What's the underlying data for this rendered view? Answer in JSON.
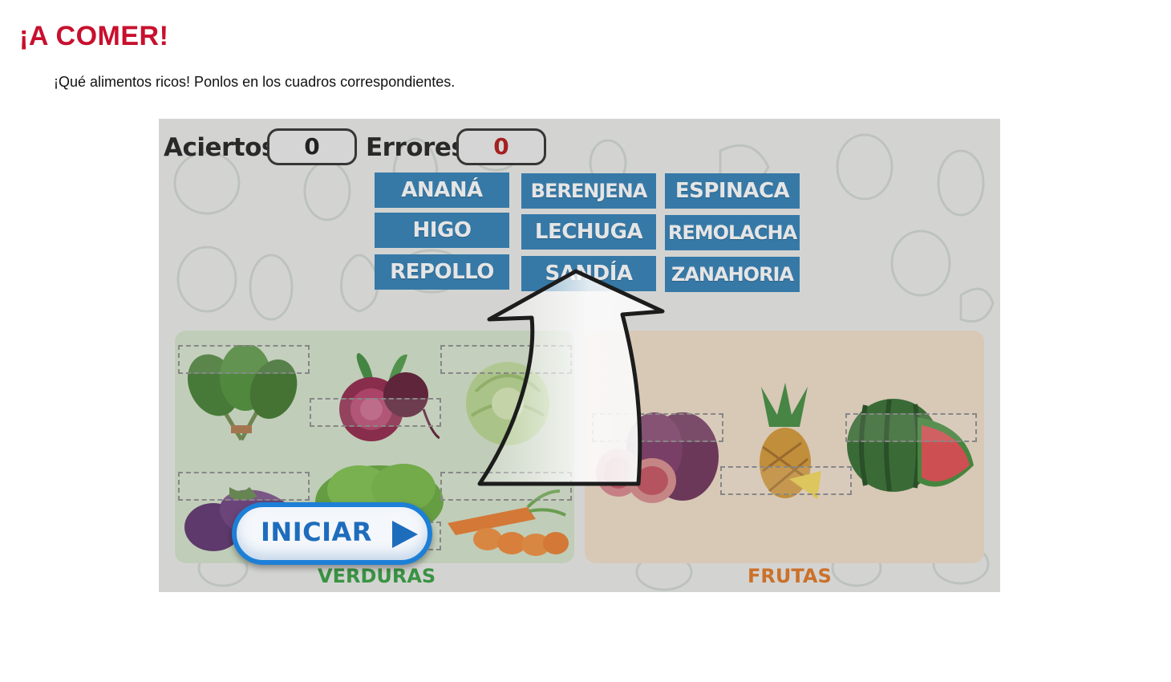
{
  "page": {
    "title": "¡A COMER!",
    "instructions": "¡Qué alimentos ricos! Ponlos en los cuadros correspondientes."
  },
  "game": {
    "score": {
      "correct_label": "Aciertos",
      "correct_value": "0",
      "errors_label": "Errores",
      "errors_value": "0"
    },
    "words": [
      "ANANÁ",
      "BERENJENA",
      "ESPINACA",
      "HIGO",
      "LECHUGA",
      "REMOLACHA",
      "REPOLLO",
      "SANDÍA",
      "ZANAHORIA"
    ],
    "categories": {
      "vegetables": "VERDURAS",
      "fruits": "FRUTAS"
    },
    "start_button": "INICIAR",
    "colors": {
      "word_tile": "#2a7cb4",
      "vegetables_label": "#2f9b3a",
      "fruits_label": "#e0721c",
      "errors_value": "#b01010",
      "start_button_border": "#1d7fd6"
    },
    "icons": [
      "spinach-image",
      "beet-image",
      "cabbage-image",
      "eggplant-image",
      "lettuce-image",
      "carrot-image",
      "fig-image",
      "pineapple-image",
      "watermelon-image",
      "play-icon",
      "arrow-hint"
    ]
  }
}
